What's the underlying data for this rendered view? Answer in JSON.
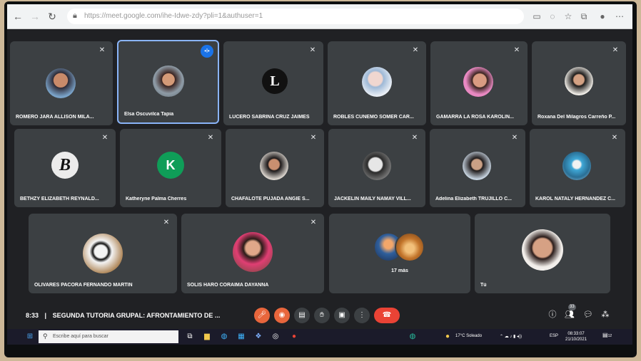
{
  "browser": {
    "url": "https://meet.google.com/ihe-Idwe-zdy?pli=1&authuser=1"
  },
  "participants": [
    {
      "name": "ROMERO JARA ALLISON MILA..."
    },
    {
      "name": "Elsa Oscuvilca Tapia"
    },
    {
      "name": "LUCERO SABRINA CRUZ JAIMES",
      "initial": "L"
    },
    {
      "name": "ROBLES CUNEMO SOMER CAR..."
    },
    {
      "name": "GAMARRA LA ROSA KAROLIN..."
    },
    {
      "name": "Roxana Del Milagros Carreño P..."
    },
    {
      "name": "BETHZY ELIZABETH REYNALD...",
      "initial": "B"
    },
    {
      "name": "Katheryne Palma Cherres",
      "initial": "K"
    },
    {
      "name": "CHAFALOTE PUJADA ANGIE S..."
    },
    {
      "name": "JACKELIN MAILY NAMAY VILL..."
    },
    {
      "name": "Adelina Elizabeth TRUJILLO C..."
    },
    {
      "name": "KAROL NATALY HERNÁNDEZ C..."
    },
    {
      "name": "OLIVARES PACORA FERNANDO MARTÍN"
    },
    {
      "name": "SOLIS HARO CORAIMA DAYANNA"
    },
    {
      "name": "17 más"
    },
    {
      "name": "Tú"
    }
  ],
  "speaking_badge": "•l•",
  "meeting": {
    "time": "8:33",
    "title": "SEGUNDA TUTORIA GRUPAL: AFRONTAMIENTO DE ..."
  },
  "people_badge": "33",
  "taskbar": {
    "search_placeholder": "Escribe aquí para buscar",
    "weather": "17°C Soleado",
    "lang": "ESP",
    "time": "08:33:07",
    "date": "21/10/2021",
    "notif_count": "12"
  },
  "colors": {
    "accent": "#1a73e8",
    "end_call": "#ea4335",
    "control": "#e8663c",
    "tile": "#3c4043",
    "active_border": "#8ab4f8",
    "avatar_k": "#0f9d58"
  }
}
